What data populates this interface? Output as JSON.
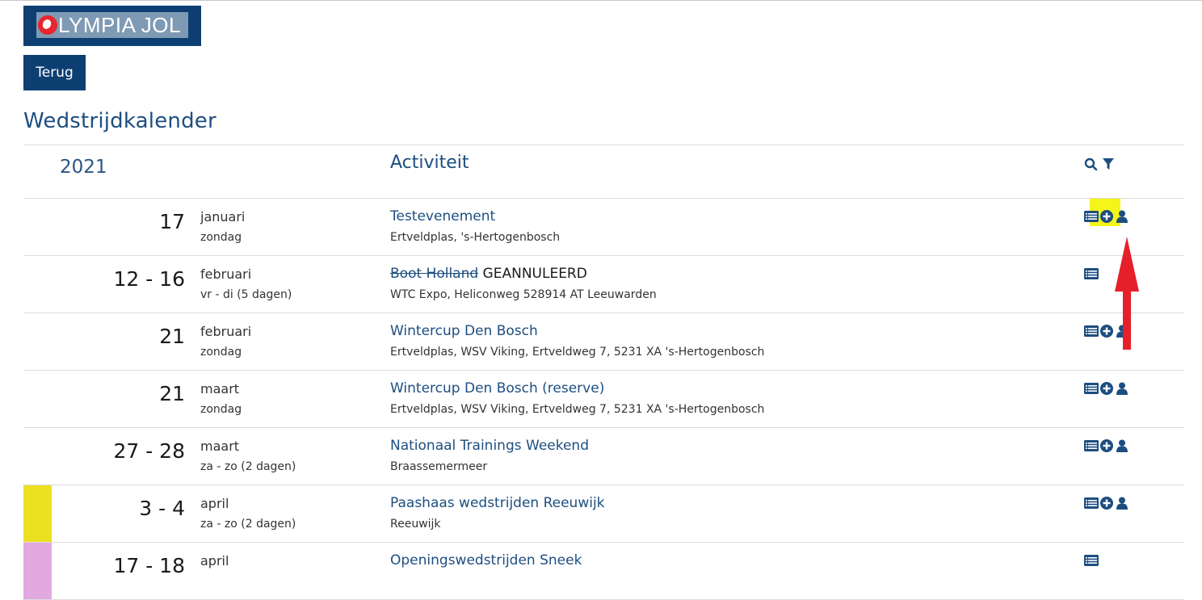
{
  "logo": {
    "text": "LYMPIA JOL",
    "colors": {
      "bg": "#0e3f73",
      "mark": "#e8262b"
    }
  },
  "back_button": {
    "label": "Terug"
  },
  "page_title": "Wedstrijdkalender",
  "table": {
    "year": "2021",
    "activity_header": "Activiteit",
    "header_icons": [
      "search-icon",
      "filter-icon"
    ],
    "rows": [
      {
        "day": "17",
        "month": "januari",
        "weekday": "zondag",
        "title": "Testevenement",
        "title_struck": "",
        "title_suffix": "",
        "location": "Ertveldplas, 's-Hertogenbosch",
        "icons": [
          "details",
          "add",
          "user"
        ],
        "color": ""
      },
      {
        "day": "12 - 16",
        "month": "februari",
        "weekday": "vr - di (5 dagen)",
        "title": "",
        "title_struck": "Boot Holland",
        "title_suffix": " GEANNULEERD",
        "location": "WTC Expo, Heliconweg 528914 AT Leeuwarden",
        "icons": [
          "details"
        ],
        "color": ""
      },
      {
        "day": "21",
        "month": "februari",
        "weekday": "zondag",
        "title": "Wintercup Den Bosch",
        "title_struck": "",
        "title_suffix": "",
        "location": "Ertveldplas, WSV Viking, Ertveldweg 7, 5231 XA 's-Hertogenbosch",
        "icons": [
          "details",
          "add",
          "user"
        ],
        "color": ""
      },
      {
        "day": "21",
        "month": "maart",
        "weekday": "zondag",
        "title": "Wintercup Den Bosch (reserve)",
        "title_struck": "",
        "title_suffix": "",
        "location": "Ertveldplas, WSV Viking, Ertveldweg 7, 5231 XA 's-Hertogenbosch",
        "icons": [
          "details",
          "add",
          "user"
        ],
        "color": ""
      },
      {
        "day": "27 - 28",
        "month": "maart",
        "weekday": "za - zo (2 dagen)",
        "title": "Nationaal Trainings Weekend",
        "title_struck": "",
        "title_suffix": "",
        "location": "Braassemermeer",
        "icons": [
          "details",
          "add",
          "user"
        ],
        "color": ""
      },
      {
        "day": "3 - 4",
        "month": "april",
        "weekday": "za - zo (2 dagen)",
        "title": "Paashaas wedstrijden Reeuwijk",
        "title_struck": "",
        "title_suffix": "",
        "location": "Reeuwijk",
        "icons": [
          "details",
          "add",
          "user"
        ],
        "color": "#ece023"
      },
      {
        "day": "17 - 18",
        "month": "april",
        "weekday": "",
        "title": "Openingswedstrijden Sneek",
        "title_struck": "",
        "title_suffix": "",
        "location": "",
        "icons": [
          "details"
        ],
        "color": "#e2a8e0"
      }
    ]
  },
  "annotation": {
    "highlight_color": "#f5f51a",
    "arrow_color": "#e5202a"
  }
}
